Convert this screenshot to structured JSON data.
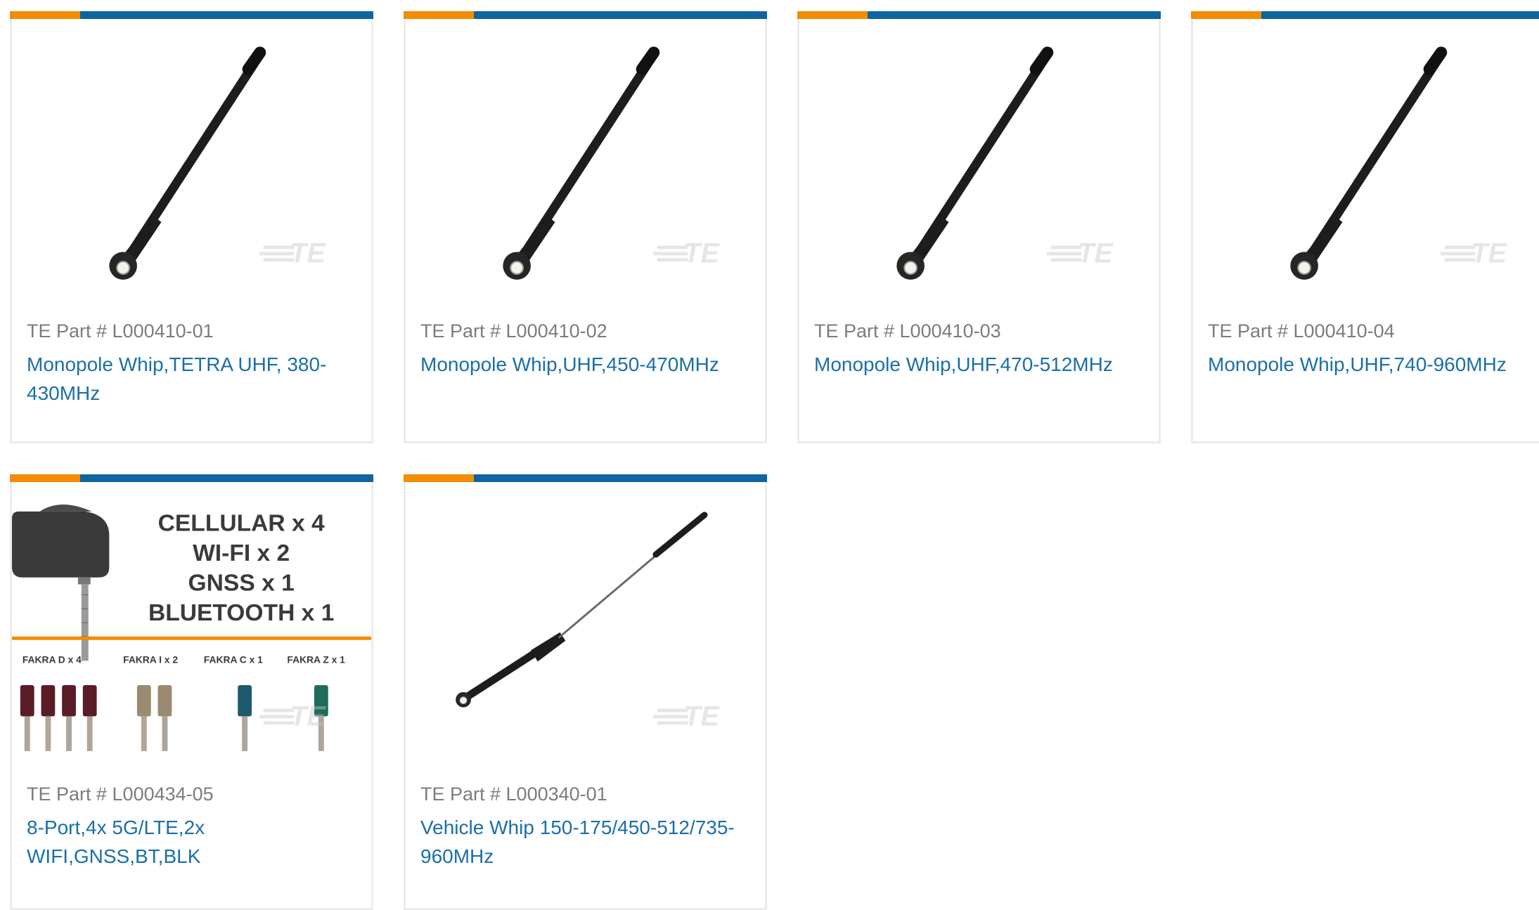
{
  "colors": {
    "accent_orange": "#f28c00",
    "accent_blue": "#0e64a0",
    "link": "#1a6fa8",
    "muted": "#7c7c7c",
    "border": "#ececec"
  },
  "watermark": "TE",
  "products": [
    {
      "part_label": "TE Part # L000410-01",
      "title": "Monopole Whip,TETRA UHF, 380-430MHz",
      "image": "monopole-whip-antenna"
    },
    {
      "part_label": "TE Part # L000410-02",
      "title": "Monopole Whip,UHF,450-470MHz",
      "image": "monopole-whip-antenna"
    },
    {
      "part_label": "TE Part # L000410-03",
      "title": "Monopole Whip,UHF,470-512MHz",
      "image": "monopole-whip-antenna"
    },
    {
      "part_label": "TE Part # L000410-04",
      "title": "Monopole Whip,UHF,740-960MHz",
      "image": "monopole-whip-antenna"
    },
    {
      "part_label": "TE Part # L000434-05",
      "title": "8-Port,4x 5G/LTE,2x WIFI,GNSS,BT,BLK",
      "image": "multiport-antenna",
      "image_text": {
        "lines": [
          "CELLULAR x 4",
          "WI-FI x 2",
          "GNSS x 1",
          "BLUETOOTH x 1"
        ],
        "connectors": [
          "FAKRA D x 4",
          "FAKRA I x 2",
          "FAKRA C x 1",
          "FAKRA Z x 1"
        ]
      }
    },
    {
      "part_label": "TE Part # L000340-01",
      "title": "Vehicle Whip 150-175/450-512/735-960MHz",
      "image": "vehicle-whip-antenna"
    }
  ]
}
